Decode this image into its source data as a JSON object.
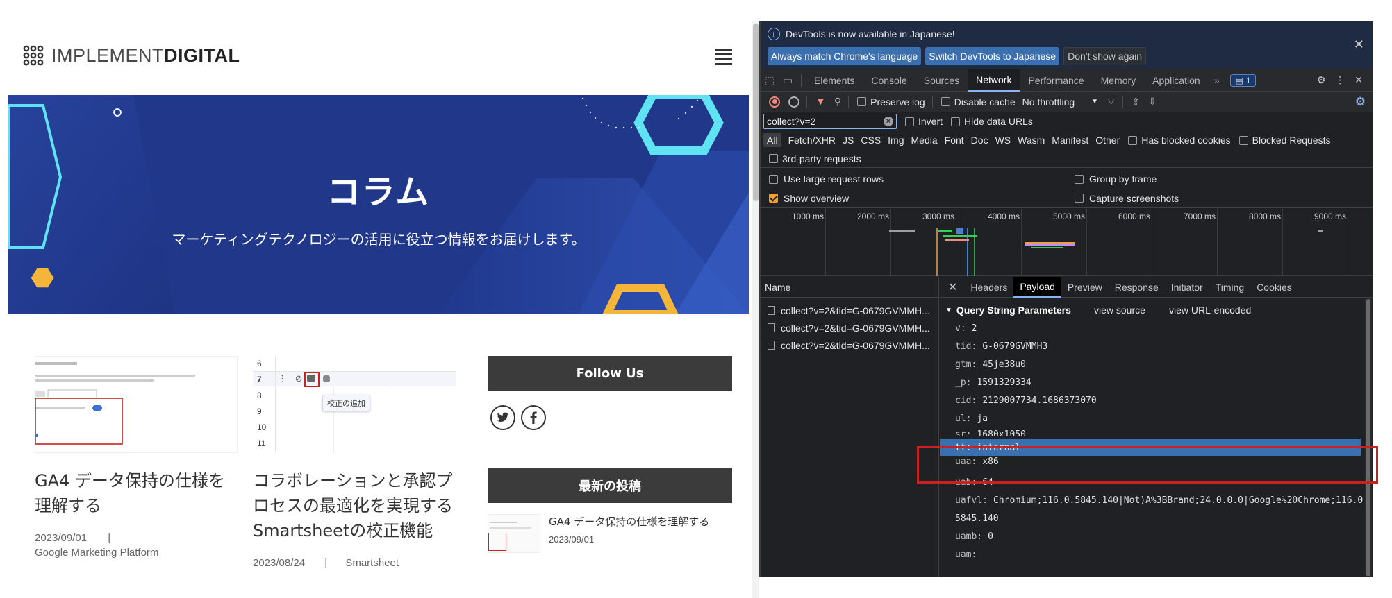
{
  "site": {
    "logo_light": "IMPLEMENT",
    "logo_bold": "DIGITAL",
    "hero_title": "コラム",
    "hero_subtitle": "マーケティングテクノロジーの活用に役立つ情報をお届けします。",
    "cards": [
      {
        "title": "GA4 データ保持の仕様を理解する",
        "date": "2023/09/01",
        "sep": "|",
        "category": "Google Marketing Platform"
      },
      {
        "title": "コラボレーションと承認プロセスの最適化を実現するSmartsheetの校正機能",
        "date": "2023/08/24",
        "sep": "|",
        "category": "Smartsheet"
      }
    ],
    "card2_thumb": {
      "rows": [
        "6",
        "7",
        "8",
        "9",
        "10",
        "11"
      ],
      "tooltip": "校正の追加"
    },
    "follow_us": "Follow Us",
    "recent_title": "最新の投稿",
    "recent_item": {
      "title": "GA4 データ保持の仕様を理解する",
      "date": "2023/09/01"
    }
  },
  "devtools": {
    "info_message": "DevTools is now available in Japanese!",
    "btn_match": "Always match Chrome's language",
    "btn_switch": "Switch DevTools to Japanese",
    "btn_dont_show": "Don't show again",
    "tabs": [
      "Elements",
      "Console",
      "Sources",
      "Network",
      "Performance",
      "Memory",
      "Application"
    ],
    "active_tab": "Network",
    "issues_count": "1",
    "toolbar": {
      "preserve_log": "Preserve log",
      "disable_cache": "Disable cache",
      "throttling": "No throttling"
    },
    "filter_value": "collect?v=2",
    "invert": "Invert",
    "hide_data_urls": "Hide data URLs",
    "types": [
      "All",
      "Fetch/XHR",
      "JS",
      "CSS",
      "Img",
      "Media",
      "Font",
      "Doc",
      "WS",
      "Wasm",
      "Manifest",
      "Other"
    ],
    "has_blocked_cookies": "Has blocked cookies",
    "blocked_requests": "Blocked Requests",
    "third_party": "3rd-party requests",
    "use_large_rows": "Use large request rows",
    "group_by_frame": "Group by frame",
    "show_overview": "Show overview",
    "capture_screenshots": "Capture screenshots",
    "timeline_ticks": [
      "1000 ms",
      "2000 ms",
      "3000 ms",
      "4000 ms",
      "5000 ms",
      "6000 ms",
      "7000 ms",
      "8000 ms",
      "9000 ms"
    ],
    "name_header": "Name",
    "requests": [
      "collect?v=2&tid=G-0679GVMMH...",
      "collect?v=2&tid=G-0679GVMMH...",
      "collect?v=2&tid=G-0679GVMMH..."
    ],
    "detail_tabs": [
      "Headers",
      "Payload",
      "Preview",
      "Response",
      "Initiator",
      "Timing",
      "Cookies"
    ],
    "active_detail_tab": "Payload",
    "qs_title": "Query String Parameters",
    "view_source": "view source",
    "view_url_encoded": "view URL-encoded",
    "params": [
      {
        "k": "v:",
        "v": "2"
      },
      {
        "k": "tid:",
        "v": "G-0679GVMMH3"
      },
      {
        "k": "gtm:",
        "v": "45je38u0"
      },
      {
        "k": "_p:",
        "v": "1591329334"
      },
      {
        "k": "cid:",
        "v": "2129007734.1686373070"
      },
      {
        "k": "ul:",
        "v": "ja"
      },
      {
        "k": "sr:",
        "v": "1680x1050"
      },
      {
        "k": "tt:",
        "v": "internal"
      },
      {
        "k": "uaa:",
        "v": "x86"
      },
      {
        "k": "uab:",
        "v": "64"
      },
      {
        "k": "uafvl:",
        "v": "Chromium;116.0.5845.140|Not)A%3BBrand;24.0.0.0|Google%20Chrome;116.0."
      },
      {
        "k": "",
        "v": "5845.140"
      },
      {
        "k": "uamb:",
        "v": "0"
      },
      {
        "k": "uam:",
        "v": ""
      }
    ],
    "highlight_param": "tt:"
  },
  "colors": {
    "hero_bg": "#21388a",
    "accent_cyan": "#5fe3f2",
    "accent_yellow": "#f4b63a",
    "highlight": "#c9211e",
    "selected_row": "#3a6fb0"
  }
}
